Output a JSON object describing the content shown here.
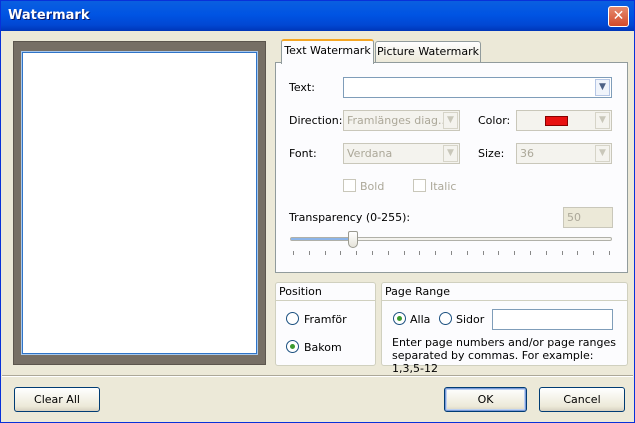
{
  "window": {
    "title": "Watermark",
    "close_symbol": "✕"
  },
  "tabs": [
    {
      "label": "Text Watermark",
      "active": true
    },
    {
      "label": "Picture Watermark",
      "active": false
    }
  ],
  "text_tab": {
    "text_label": "Text:",
    "text_value": "",
    "direction_label": "Direction:",
    "direction_value": "Framlänges diag...",
    "color_label": "Color:",
    "color_value": "#e81010",
    "font_label": "Font:",
    "font_value": "Verdana",
    "size_label": "Size:",
    "size_value": "36",
    "bold_label": "Bold",
    "italic_label": "Italic",
    "transparency_label": "Transparency (0-255):",
    "transparency_value": "50",
    "transparency_fraction": 0.196
  },
  "position_group": {
    "title": "Position",
    "options": [
      {
        "label": "Framför",
        "selected": false
      },
      {
        "label": "Bakom",
        "selected": true
      }
    ]
  },
  "page_range_group": {
    "title": "Page Range",
    "all_label": "Alla",
    "all_selected": true,
    "pages_label": "Sidor",
    "pages_selected": false,
    "pages_value": "",
    "hint": "Enter page numbers and/or page ranges separated by commas. For example: 1,3,5-12"
  },
  "buttons": {
    "clear_all": "Clear All",
    "ok": "OK",
    "cancel": "Cancel"
  },
  "icons": {
    "dropdown": "▼",
    "close": "close-icon"
  }
}
